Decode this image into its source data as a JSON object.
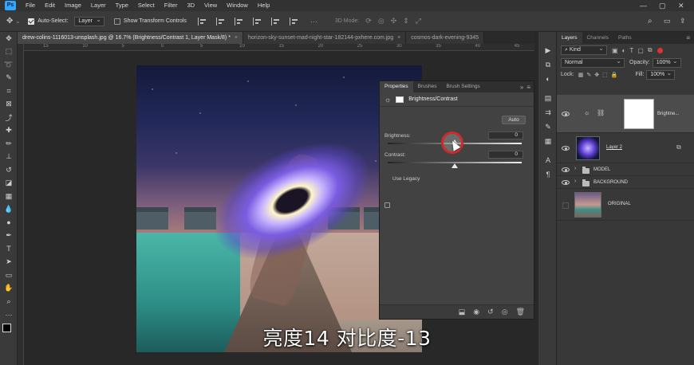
{
  "menubar": {
    "logo": "Ps",
    "items": [
      "File",
      "Edit",
      "Image",
      "Layer",
      "Type",
      "Select",
      "Filter",
      "3D",
      "View",
      "Window",
      "Help"
    ]
  },
  "options_bar": {
    "auto_select_label": "Auto-Select:",
    "auto_select_value": "Layer",
    "show_transform_label": "Show Transform Controls",
    "mode_3d_label": "3D Mode:"
  },
  "tabs": [
    {
      "label": "drew-colins-1116013-unsplash.jpg @ 16.7% (Brightness/Contrast 1, Layer Mask/8) *",
      "close": "×"
    },
    {
      "label": "horizon-sky-sunset-mad-night-star-182144-pxhere.com.jpg",
      "close": "×"
    },
    {
      "label": "cosmos-dark-evening-9345",
      "close": ""
    }
  ],
  "ruler": {
    "h_ticks": [
      "15",
      "10",
      "5",
      "0",
      "5",
      "10",
      "15",
      "20",
      "25",
      "30",
      "35",
      "40",
      "45"
    ]
  },
  "subtitle": "亮度14 对比度-13",
  "properties": {
    "tabs": [
      "Properties",
      "Brushes",
      "Brush Settings"
    ],
    "title": "Brightness/Contrast",
    "auto_label": "Auto",
    "brightness_label": "Brightness:",
    "brightness_value": "0",
    "brightness_level": 0.5,
    "contrast_label": "Contrast:",
    "contrast_value": "0",
    "contrast_level": 0.5,
    "legacy_label": "Use Legacy"
  },
  "layers": {
    "tabs": [
      "Layers",
      "Channels",
      "Paths"
    ],
    "kind_label": "Kind",
    "blend_mode": "Normal",
    "opacity_label": "Opacity:",
    "opacity_value": "100%",
    "lock_label": "Lock:",
    "fill_label": "Fill:",
    "fill_value": "100%",
    "items": [
      {
        "name": "Brightne..."
      },
      {
        "name": "Layer 2"
      },
      {
        "name": "MODEL"
      },
      {
        "name": "BACKGROUND"
      },
      {
        "name": "ORIGINAL"
      }
    ]
  },
  "colors": {
    "accent": "#31a8ff",
    "cursor_ring": "#cc2b2b"
  }
}
